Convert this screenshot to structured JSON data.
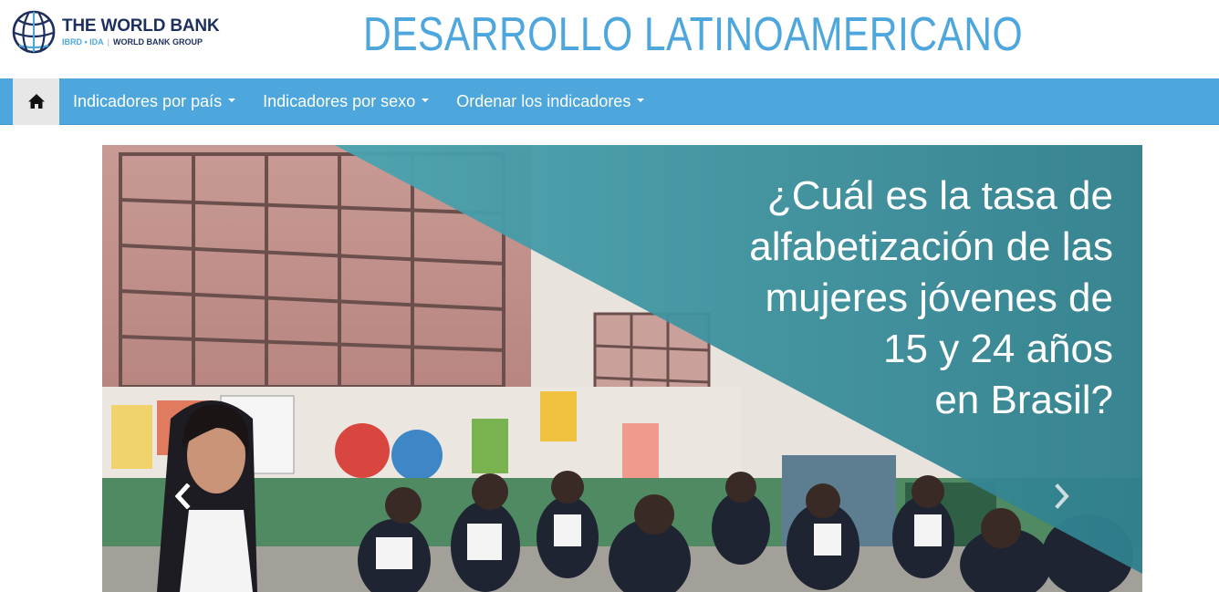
{
  "header": {
    "logo": {
      "name": "THE WORLD BANK",
      "ibrd_ida": "IBRD • IDA",
      "separator": "|",
      "group": "WORLD BANK GROUP"
    },
    "site_title": "DESARROLLO LATINOAMERICANO"
  },
  "nav": {
    "home_icon": "home-icon",
    "items": [
      {
        "label": "Indicadores por país"
      },
      {
        "label": "Indicadores por sexo"
      },
      {
        "label": "Ordenar los indicadores"
      }
    ]
  },
  "carousel": {
    "caption_lines": [
      "¿Cuál es la tasa de",
      "alfabetización de las",
      "mujeres jóvenes de",
      "15 y 24 años",
      "en Brasil?"
    ],
    "prev_icon": "chevron-left-icon",
    "next_icon": "chevron-right-icon"
  },
  "colors": {
    "brand_blue": "#4ea7dc",
    "navy": "#1d2f5d",
    "teal_overlay": "#3f9aa8",
    "home_bg": "#e7e7e7"
  }
}
